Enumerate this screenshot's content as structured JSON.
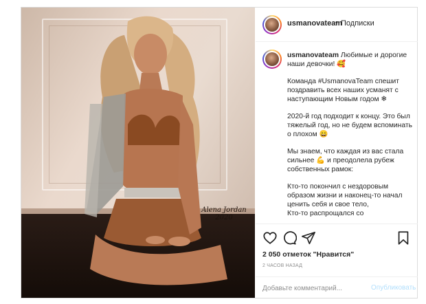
{
  "post": {
    "username": "usmanovateam",
    "dot": "•",
    "follow_label": "Подписки",
    "watermark_line1": "Alena Jordan",
    "watermark_line2": "2020",
    "caption": {
      "username": "usmanovateam",
      "p1": "Любимые и дорогие наши девочки! 🥰",
      "p2": "Команда #UsmanovaTeam спешит поздравить всех наших усманят с наступающим Новым годом ❄",
      "p3": "2020-й год подходит к концу. Это был тяжелый год, но не будем вспоминать о плохом 😄",
      "p4": "Мы знаем, что каждая из вас стала сильнее 💪 и преодолела рубеж собственных рамок:",
      "p5": "Кто-то покончил с нездоровым образом жизни и наконец-то начал ценить себя и свое тело,",
      "p6": "Кто-то распрощался со"
    },
    "likes_text": "2 050 отметок \"Нравится\"",
    "time_text": "2 часов назад",
    "comment_placeholder": "Добавьте комментарий...",
    "publish_label": "Опубликовать"
  },
  "icons": {
    "like": "heart-icon",
    "comment": "comment-icon",
    "share": "paper-plane-icon",
    "save": "bookmark-icon"
  },
  "colors": {
    "border": "#dbdbdb",
    "text": "#262626",
    "muted": "#8e8e8e",
    "publish_disabled": "#b2dffc"
  }
}
